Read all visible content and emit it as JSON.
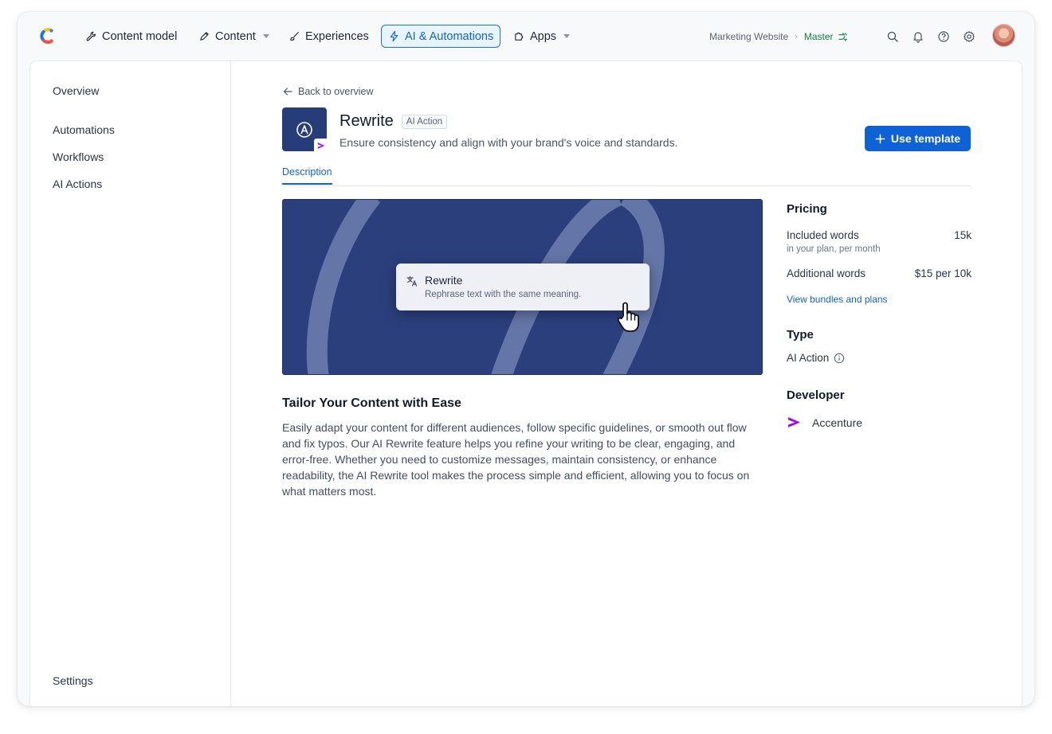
{
  "nav": {
    "items": [
      {
        "label": "Content model"
      },
      {
        "label": "Content"
      },
      {
        "label": "Experiences"
      },
      {
        "label": "AI & Automations"
      },
      {
        "label": "Apps"
      }
    ],
    "space": "Marketing Website",
    "environment": "Master"
  },
  "sidebar": {
    "overview": "Overview",
    "items": [
      "Automations",
      "Workflows",
      "AI Actions"
    ],
    "settings": "Settings"
  },
  "detail": {
    "back": "Back to overview",
    "title": "Rewrite",
    "tag": "AI Action",
    "subtitle": "Ensure consistency and align with your brand's voice and standards.",
    "cta": "Use template",
    "tab": "Description",
    "popup_title": "Rewrite",
    "popup_desc": "Rephrase text with the same meaning.",
    "heading": "Tailor Your Content with Ease",
    "body": "Easily adapt your content for different audiences, follow specific guidelines, or smooth out flow and fix typos. Our AI Rewrite feature helps you refine your writing to be clear, engaging, and error-free. Whether you need to customize messages, maintain consistency, or enhance readability, the AI Rewrite tool makes the process simple and efficient, allowing you to focus on what matters most."
  },
  "pricing": {
    "heading": "Pricing",
    "included_label": "Included words",
    "included_value": "15k",
    "included_note": "in your plan, per month",
    "additional_label": "Additional words",
    "additional_value": "$15 per 10k",
    "link": "View bundles and plans"
  },
  "type": {
    "heading": "Type",
    "value": "AI Action"
  },
  "developer": {
    "heading": "Developer",
    "name": "Accenture"
  },
  "colors": {
    "accent": "#0f62d6",
    "hero": "#2b3f7d",
    "accenture": "#a100ff",
    "env": "#12803e"
  }
}
